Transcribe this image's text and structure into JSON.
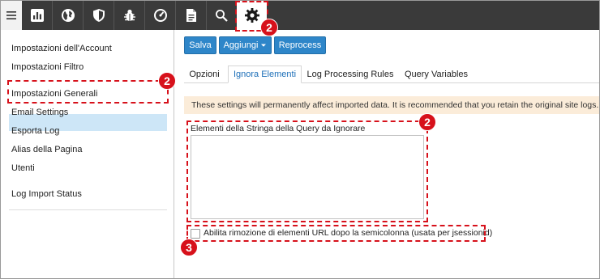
{
  "toolbar": {
    "icons": [
      "menu-icon",
      "chart-icon",
      "globe-icon",
      "shield-icon",
      "bug-icon",
      "speedometer-icon",
      "document-icon",
      "search-icon",
      "gear-icon"
    ],
    "badge": "2"
  },
  "sidebar": {
    "items": [
      {
        "label": "Impostazioni dell'Account"
      },
      {
        "label": "Impostazioni Filtro"
      },
      {
        "label": "Impostazioni Generali"
      },
      {
        "label": "Email Settings"
      },
      {
        "label": "Esporta Log"
      },
      {
        "label": "Alias della Pagina"
      },
      {
        "label": "Utenti"
      },
      {
        "label": "Log Import Status"
      }
    ],
    "selected_badge": "2"
  },
  "actions": {
    "save": "Salva",
    "add": "Aggiungi",
    "reprocess": "Reprocess"
  },
  "tabs": [
    {
      "label": "Opzioni"
    },
    {
      "label": "Ignora Elementi"
    },
    {
      "label": "Log Processing Rules"
    },
    {
      "label": "Query Variables"
    }
  ],
  "notice": "These settings will permanently affect imported data. It is recommended that you retain the original site logs.",
  "query_field": {
    "label": "Elementi della Stringa della Query da Ignorare",
    "value": "",
    "badge": "2"
  },
  "jsession_option": {
    "label": "Abilita rimozione di elementi URL dopo la semicolonna (usata per jsessionid)",
    "badge": "3",
    "checked": false
  },
  "colors": {
    "toolbar": "#3a3a3a",
    "accent": "#2e86c9",
    "highlight": "#d7111b",
    "selected": "#cde6f7",
    "notice": "#fbecd9"
  }
}
